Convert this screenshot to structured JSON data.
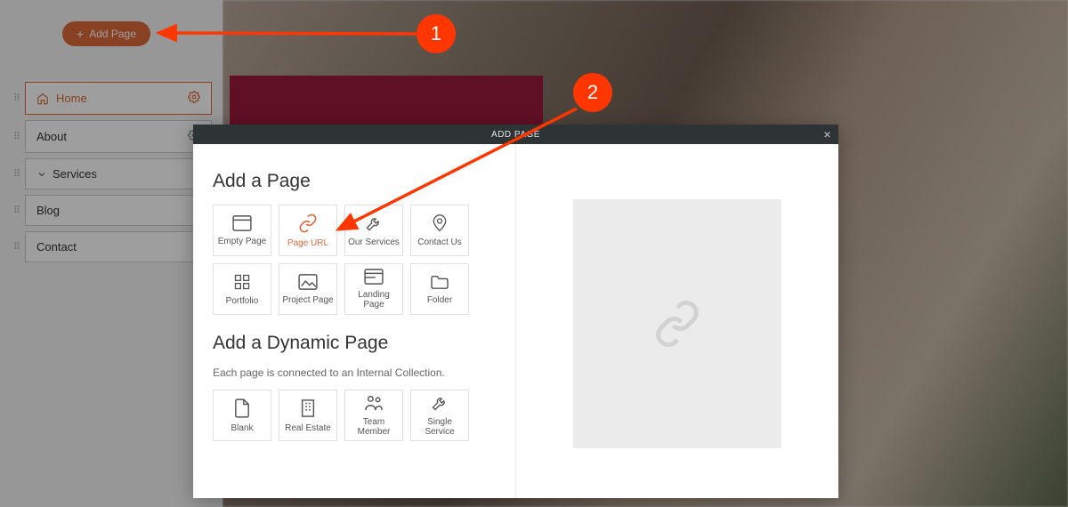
{
  "sidebar": {
    "add_page_label": "Add Page",
    "items": [
      {
        "label": "Home",
        "active": true,
        "has_gear": true,
        "icon": "home"
      },
      {
        "label": "About",
        "active": false,
        "has_gear": true,
        "icon": null
      },
      {
        "label": "Services",
        "active": false,
        "has_gear": false,
        "icon": "chevron"
      },
      {
        "label": "Blog",
        "active": false,
        "has_gear": false,
        "icon": null
      },
      {
        "label": "Contact",
        "active": false,
        "has_gear": false,
        "icon": null
      }
    ]
  },
  "modal": {
    "title": "ADD PAGE",
    "add_page_heading": "Add a Page",
    "dynamic_heading": "Add a Dynamic Page",
    "dynamic_sub": "Each page is connected to an Internal Collection.",
    "tiles": [
      {
        "label": "Empty Page",
        "icon": "window"
      },
      {
        "label": "Page URL",
        "icon": "link",
        "highlight": true
      },
      {
        "label": "Our Services",
        "icon": "wrench"
      },
      {
        "label": "Contact Us",
        "icon": "pin"
      },
      {
        "label": "Portfolio",
        "icon": "grid"
      },
      {
        "label": "Project Page",
        "icon": "image"
      },
      {
        "label": "Landing Page",
        "icon": "layout"
      },
      {
        "label": "Folder",
        "icon": "folder"
      }
    ],
    "dyn_tiles": [
      {
        "label": "Blank",
        "icon": "file"
      },
      {
        "label": "Real Estate",
        "icon": "building"
      },
      {
        "label": "Team Member",
        "icon": "people"
      },
      {
        "label": "Single Service",
        "icon": "wrench"
      }
    ]
  },
  "annotations": {
    "step1": "1",
    "step2": "2"
  }
}
